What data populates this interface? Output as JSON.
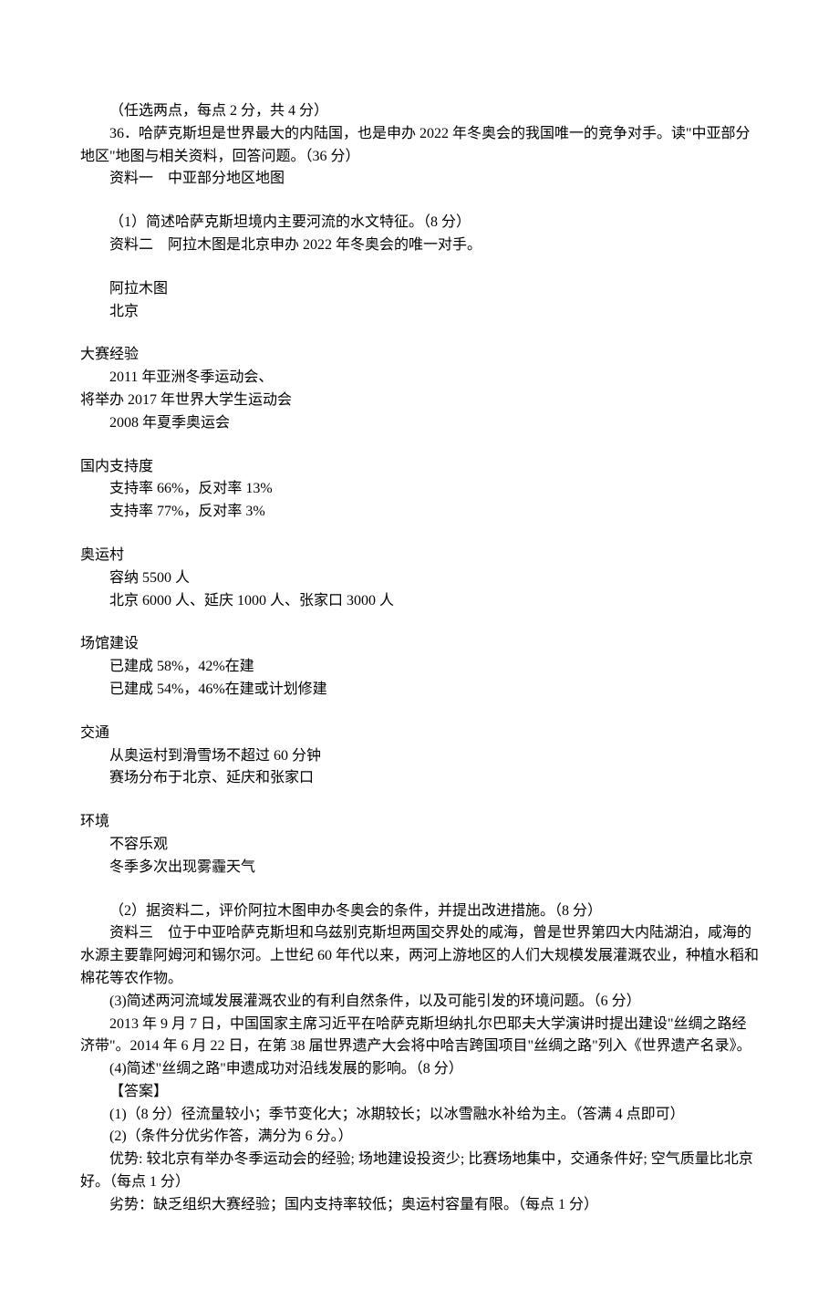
{
  "p1": "（任选两点，每点 2 分，共 4 分）",
  "p2": "36．哈萨克斯坦是世界最大的内陆国，也是申办 2022 年冬奥会的我国唯一的竞争对手。读\"中亚部分地区\"地图与相关资料，回答问题。（36 分）",
  "p3": "资料一　中亚部分地区地图",
  "p4": "（1）简述哈萨克斯坦境内主要河流的水文特征。（8 分）",
  "p5": "资料二　阿拉木图是北京申办 2022 年冬奥会的唯一对手。",
  "table": {
    "col1": "阿拉木图",
    "col2": "北京",
    "rows": [
      {
        "hdr": "大赛经验",
        "a": "2011 年亚洲冬季运动会、",
        "a2": "将举办 2017 年世界大学生运动会",
        "b": "2008 年夏季奥运会"
      },
      {
        "hdr": "国内支持度",
        "a": "支持率 66%，反对率 13%",
        "b": "支持率 77%，反对率 3%"
      },
      {
        "hdr": "奥运村",
        "a": "容纳 5500 人",
        "b": "北京 6000 人、延庆 1000 人、张家口 3000 人"
      },
      {
        "hdr": "场馆建设",
        "a": "已建成 58%，42%在建",
        "b": "已建成 54%，46%在建或计划修建"
      },
      {
        "hdr": "交通",
        "a": "从奥运村到滑雪场不超过 60 分钟",
        "b": "赛场分布于北京、延庆和张家口"
      },
      {
        "hdr": "环境",
        "a": "不容乐观",
        "b": "冬季多次出现雾霾天气"
      }
    ]
  },
  "p6": "（2）据资料二，评价阿拉木图申办冬奥会的条件，并提出改进措施。（8 分）",
  "p7": "资料三　位于中亚哈萨克斯坦和乌兹别克斯坦两国交界处的咸海，曾是世界第四大内陆湖泊，咸海的水源主要靠阿姆河和锡尔河。上世纪 60 年代以来，两河上游地区的人们大规模发展灌溉农业，种植水稻和棉花等农作物。",
  "p8": "(3)简述两河流域发展灌溉农业的有利自然条件，以及可能引发的环境问题。（6 分）",
  "p9": "2013 年 9 月 7 日，中国国家主席习近平在哈萨克斯坦纳扎尔巴耶夫大学演讲时提出建设\"丝绸之路经济带\"。2014 年 6 月 22 日，在第 38 届世界遗产大会将中哈吉跨国项目\"丝绸之路\"列入《世界遗产名录》。",
  "p10": "(4)简述\"丝绸之路\"申遗成功对沿线发展的影响。（8 分）",
  "p11": "【答案】",
  "p12": "(1)（8 分）径流量较小；季节变化大；冰期较长；以冰雪融水补给为主。（答满 4 点即可）",
  "p13": "(2)（条件分优劣作答，满分为 6 分。）",
  "p14": "优势: 较北京有举办冬季运动会的经验; 场地建设投资少; 比赛场地集中，交通条件好; 空气质量比北京好。（每点 1 分）",
  "p15": "劣势：缺乏组织大赛经验；国内支持率较低；奥运村容量有限。（每点 1 分）"
}
